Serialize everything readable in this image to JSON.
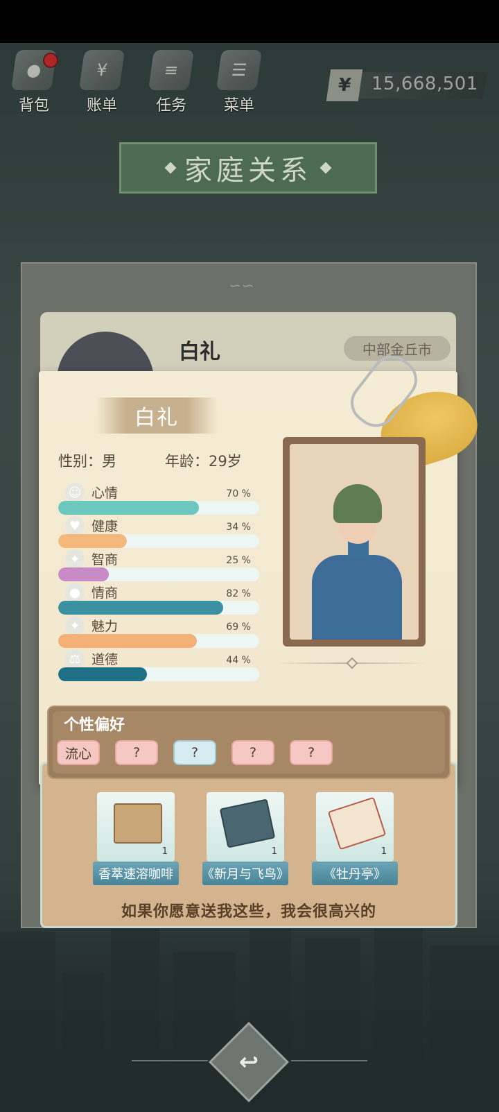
{
  "toolbar": {
    "items": [
      {
        "label": "背包",
        "icon": "bag-icon",
        "glyph": "●"
      },
      {
        "label": "账单",
        "icon": "bill-icon",
        "glyph": "¥"
      },
      {
        "label": "任务",
        "icon": "task-icon",
        "glyph": "≡"
      },
      {
        "label": "菜单",
        "icon": "menu-icon",
        "glyph": "☰"
      }
    ],
    "money": "15,668,501",
    "currency": "¥"
  },
  "title": "家庭关系",
  "back_card": {
    "name": "白礼",
    "location": "中部金丘市"
  },
  "profile": {
    "name": "白礼",
    "gender_label": "性别：男",
    "age_label": "年龄：29岁",
    "stats": [
      {
        "name": "心情",
        "value": "70 %",
        "percent": 70,
        "color": "#6cc7bf",
        "icon": "mood-icon",
        "glyph": "☺"
      },
      {
        "name": "健康",
        "value": "34 %",
        "percent": 34,
        "color": "#f4b77c",
        "icon": "heart-icon",
        "glyph": "♥"
      },
      {
        "name": "智商",
        "value": "25 %",
        "percent": 25,
        "color": "#c98bc7",
        "icon": "bulb-icon",
        "glyph": "✦"
      },
      {
        "name": "情商",
        "value": "82 %",
        "percent": 82,
        "color": "#3a8fa0",
        "icon": "apple-icon",
        "glyph": "●"
      },
      {
        "name": "魅力",
        "value": "69 %",
        "percent": 69,
        "color": "#f4b077",
        "icon": "sparkle-icon",
        "glyph": "✦"
      },
      {
        "name": "道德",
        "value": "44 %",
        "percent": 44,
        "color": "#1f6f86",
        "icon": "scale-icon",
        "glyph": "⚖"
      }
    ]
  },
  "preferences": {
    "title": "个性偏好",
    "tags": [
      "流心",
      "?",
      "?",
      "?",
      "?"
    ]
  },
  "gifts": {
    "items": [
      {
        "label": "香萃速溶咖啡",
        "count": "1"
      },
      {
        "label": "《新月与飞鸟》",
        "count": "1"
      },
      {
        "label": "《牡丹亭》",
        "count": "1"
      }
    ],
    "message": "如果你愿意送我这些，我会很高兴的"
  }
}
